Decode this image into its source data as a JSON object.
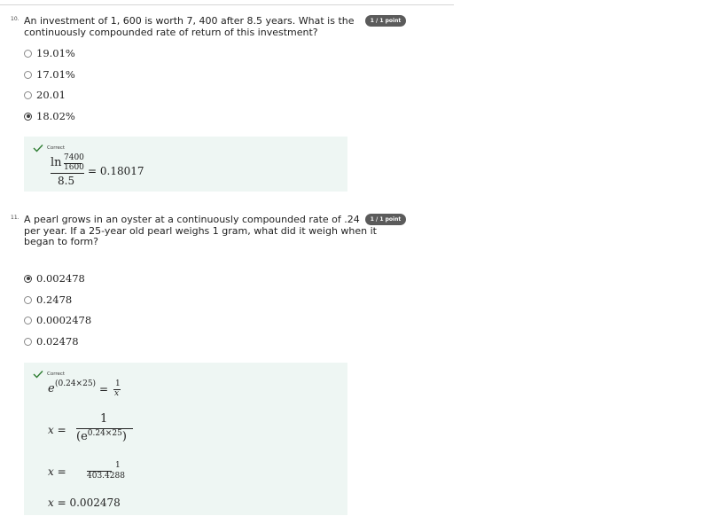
{
  "questions": [
    {
      "number": "10.",
      "text_line1": "An investment of 1, 600 is worth 7, 400 after 8.5 years. What is the",
      "text_line2": "continuously compounded rate of return of this investment?",
      "points": "1 / 1 point",
      "options": [
        {
          "label": "19.01%",
          "selected": false
        },
        {
          "label": "17.01%",
          "selected": false
        },
        {
          "label": "20.01",
          "selected": false
        },
        {
          "label": "18.02%",
          "selected": true
        }
      ],
      "feedback": {
        "status": "Correct",
        "ln": "ln",
        "num_top": "7400",
        "num_bottom": "1600",
        "denominator": "8.5",
        "result": "= 0.18017"
      }
    },
    {
      "number": "11.",
      "text_line1": "A pearl grows in an oyster at a continuously compounded rate of .24",
      "text_line2": "per year. If a 25-year old pearl weighs 1 gram, what did it weigh when it",
      "text_line3": "began to form?",
      "points": "1 / 1 point",
      "options": [
        {
          "label": "0.002478",
          "selected": true
        },
        {
          "label": "0.2478",
          "selected": false
        },
        {
          "label": "0.0002478",
          "selected": false
        },
        {
          "label": "0.02478",
          "selected": false
        }
      ],
      "feedback": {
        "status": "Correct",
        "eq1_base": "e",
        "eq1_exp": "(0.24×25)",
        "eq1_eq": "=",
        "eq1_num": "1",
        "eq1_den": "x",
        "eq2_lhs": "x =",
        "eq2_num": "1",
        "eq2_den_open": "(e",
        "eq2_den_exp": "0.24×25",
        "eq2_den_close": ")",
        "eq3_lhs": "x =",
        "eq3_num": "1",
        "eq3_den": "403.4288",
        "eq4_lhs": "x",
        "eq4_rhs": "= 0.002478"
      }
    }
  ],
  "colors": {
    "feedback_bg": "#eef6f3",
    "check": "#2e7d32",
    "badge_bg": "#5b5b5b"
  }
}
